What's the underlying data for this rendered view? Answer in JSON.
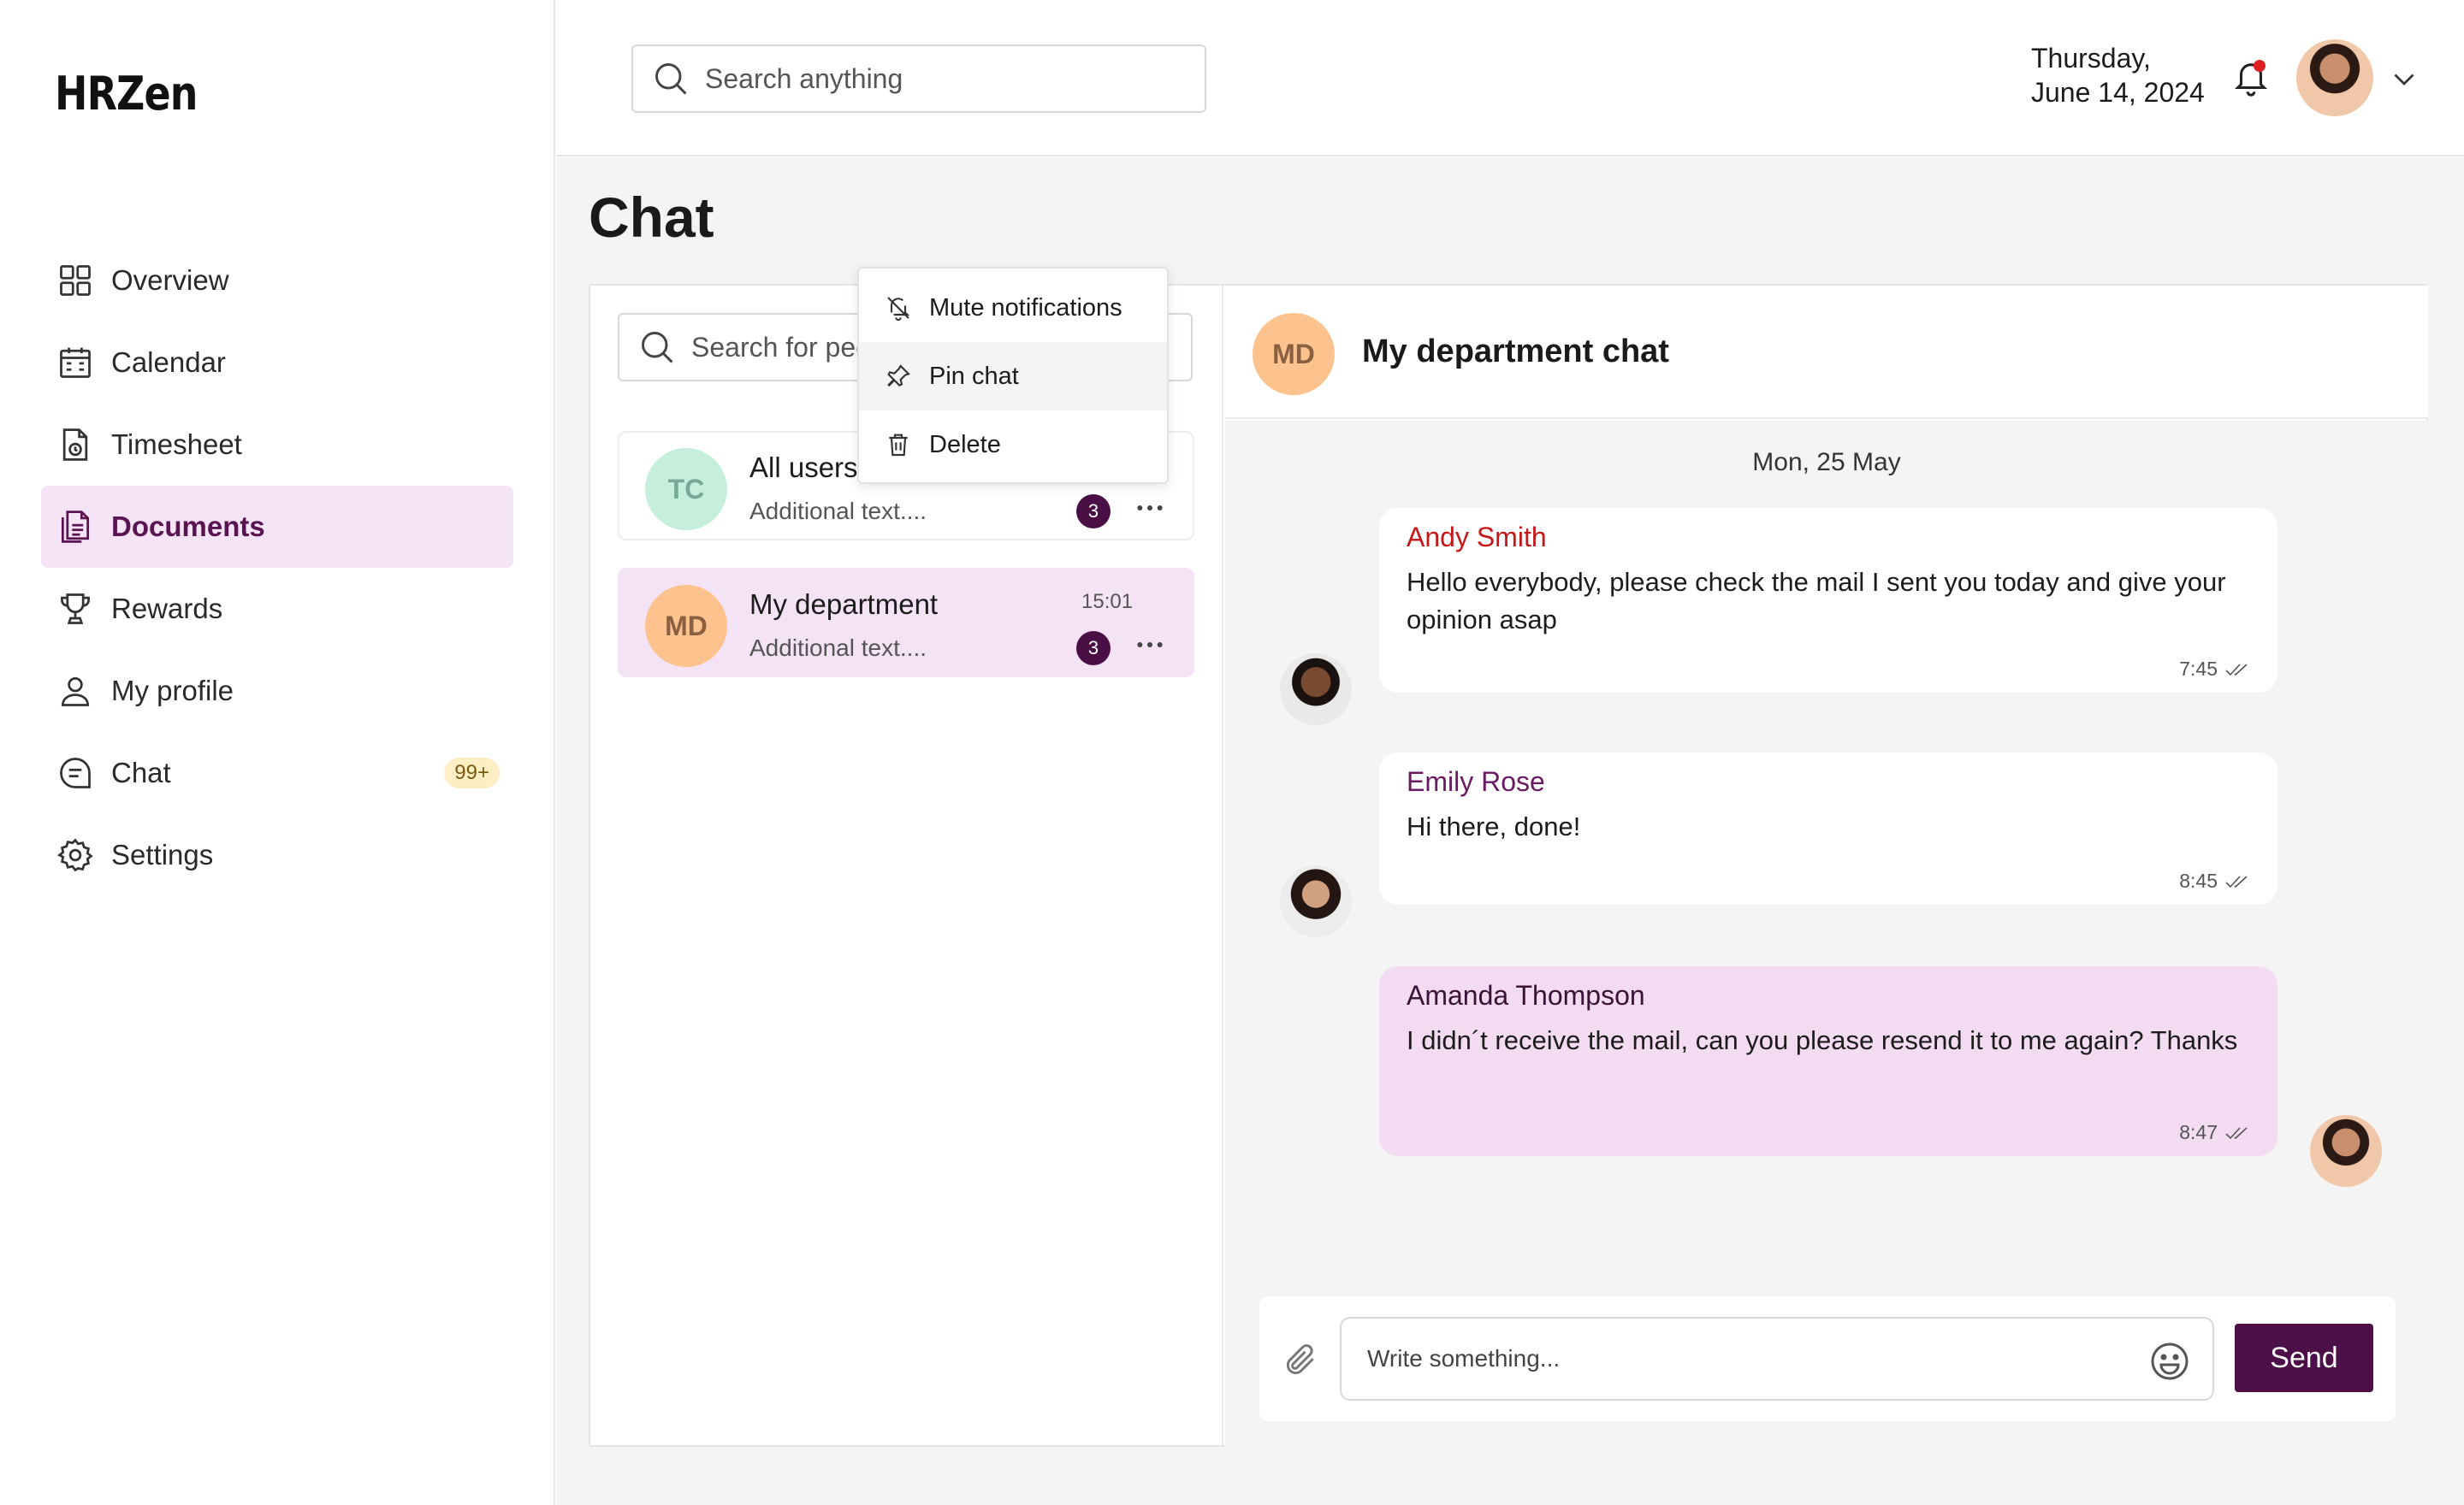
{
  "app": {
    "logo": "HRZen"
  },
  "sidebar": {
    "items": [
      {
        "label": "Overview",
        "icon": "grid-icon"
      },
      {
        "label": "Calendar",
        "icon": "calendar-icon"
      },
      {
        "label": "Timesheet",
        "icon": "timesheet-icon"
      },
      {
        "label": "Documents",
        "icon": "documents-icon",
        "active": true
      },
      {
        "label": "Rewards",
        "icon": "trophy-icon"
      },
      {
        "label": "My profile",
        "icon": "user-icon"
      },
      {
        "label": "Chat",
        "icon": "chat-icon",
        "badge": "99+"
      },
      {
        "label": "Settings",
        "icon": "gear-icon"
      }
    ]
  },
  "topbar": {
    "search_placeholder": "Search anything",
    "date_line1": "Thursday,",
    "date_line2": "June 14, 2024"
  },
  "page": {
    "title": "Chat"
  },
  "chat_list": {
    "search_placeholder": "Search for people",
    "conversations": [
      {
        "initials": "TC",
        "name": "All users",
        "subtitle": "Additional text....",
        "time": "",
        "unread": "3",
        "avatar_color": "#c5efdc",
        "initials_color": "#7aa898"
      },
      {
        "initials": "MD",
        "name": "My department",
        "subtitle": "Additional text....",
        "time": "15:01",
        "unread": "3",
        "avatar_color": "#fcc38e",
        "initials_color": "#8a6040"
      }
    ]
  },
  "context_menu": {
    "items": [
      {
        "label": "Mute notifications",
        "icon": "bell-off-icon"
      },
      {
        "label": "Pin chat",
        "icon": "pin-icon"
      },
      {
        "label": "Delete",
        "icon": "trash-icon"
      }
    ]
  },
  "conversation": {
    "initials": "MD",
    "title": "My department chat",
    "day_separator": "Mon, 25 May",
    "messages": [
      {
        "sender": "Andy Smith",
        "sender_color": "#c41818",
        "text": "Hello everybody, please check the mail I sent you today and give your opinion asap",
        "time": "7:45"
      },
      {
        "sender": "Emily Rose",
        "sender_color": "#6a1a62",
        "text": "Hi there, done!",
        "time": "8:45"
      },
      {
        "sender": "Amanda Thompson",
        "sender_color": "#3a1236",
        "text": "I didn´t receive the mail, can you please resend it to me again? Thanks",
        "time": "8:47"
      }
    ]
  },
  "composer": {
    "placeholder": "Write something...",
    "send_label": "Send"
  },
  "colors": {
    "accent": "#4d0f48",
    "active_bg": "#f4e4f6",
    "badge_bg": "#fdeec4"
  }
}
